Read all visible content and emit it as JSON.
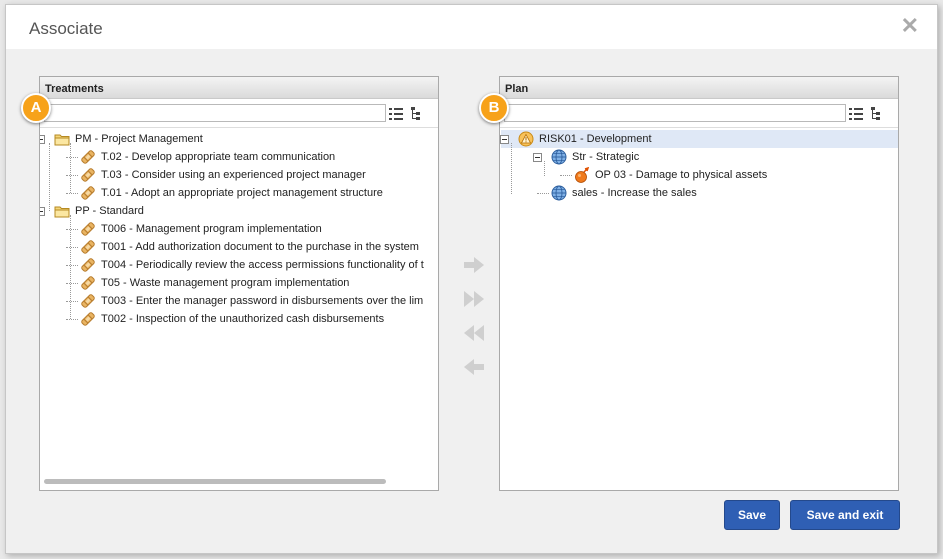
{
  "dialog": {
    "title": "Associate",
    "close_label": "✕"
  },
  "left_panel": {
    "title": "Treatments",
    "badge": "A",
    "search_value": "",
    "tree": [
      {
        "label": "PM - Project Management",
        "kind": "folder",
        "level": 0
      },
      {
        "label": "T.02 - Develop appropriate team communication",
        "kind": "treatment",
        "level": 1
      },
      {
        "label": "T.03 - Consider using an experienced project manager",
        "kind": "treatment",
        "level": 1
      },
      {
        "label": "T.01 - Adopt an appropriate project management structure",
        "kind": "treatment",
        "level": 1
      },
      {
        "label": "PP - Standard",
        "kind": "folder",
        "level": 0
      },
      {
        "label": "T006 - Management program implementation",
        "kind": "treatment",
        "level": 1
      },
      {
        "label": "T001 - Add authorization document to the purchase in the system",
        "kind": "treatment",
        "level": 1
      },
      {
        "label": "T004 - Periodically review the access permissions functionality of t",
        "kind": "treatment",
        "level": 1
      },
      {
        "label": "T05 - Waste management program implementation",
        "kind": "treatment",
        "level": 1
      },
      {
        "label": "T003 - Enter the manager password in disbursements over the lim",
        "kind": "treatment",
        "level": 1
      },
      {
        "label": "T002 - Inspection of the unauthorized cash disbursements",
        "kind": "treatment",
        "level": 1
      }
    ]
  },
  "right_panel": {
    "title": "Plan",
    "badge": "B",
    "search_value": "",
    "tree": [
      {
        "label": "RISK01 - Development",
        "kind": "risk",
        "level": 0,
        "selected": true
      },
      {
        "label": "Str - Strategic",
        "kind": "globe",
        "level": 1
      },
      {
        "label": "OP 03 - Damage to physical assets",
        "kind": "damage",
        "level": 2
      },
      {
        "label": "sales - Increase the sales",
        "kind": "globe",
        "level": 1
      }
    ]
  },
  "buttons": {
    "save": "Save",
    "save_exit": "Save and exit"
  },
  "colors": {
    "primary_button": "#2f5fb4",
    "badge": "#f7a21a",
    "selection": "#dfe8f6"
  }
}
